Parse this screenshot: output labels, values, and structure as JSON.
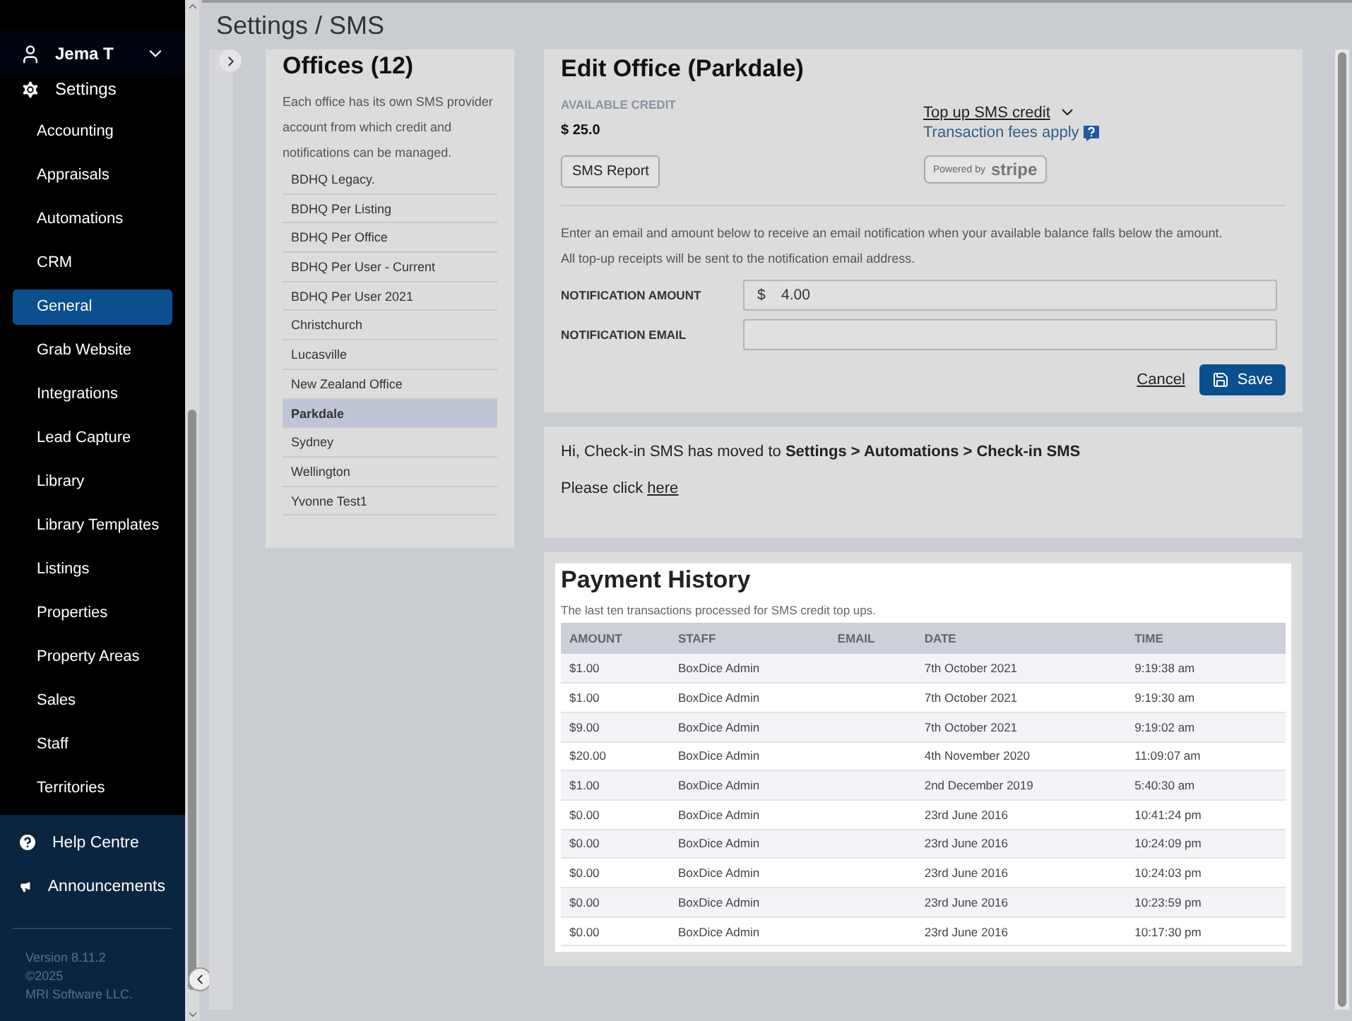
{
  "sidebar": {
    "user": "Jema T",
    "section": "Settings",
    "items": [
      {
        "label": "Accounting",
        "selected": false
      },
      {
        "label": "Appraisals",
        "selected": false
      },
      {
        "label": "Automations",
        "selected": false
      },
      {
        "label": "CRM",
        "selected": false
      },
      {
        "label": "General",
        "selected": true
      },
      {
        "label": "Grab Website",
        "selected": false
      },
      {
        "label": "Integrations",
        "selected": false
      },
      {
        "label": "Lead Capture",
        "selected": false
      },
      {
        "label": "Library",
        "selected": false
      },
      {
        "label": "Library Templates",
        "selected": false
      },
      {
        "label": "Listings",
        "selected": false
      },
      {
        "label": "Properties",
        "selected": false
      },
      {
        "label": "Property Areas",
        "selected": false
      },
      {
        "label": "Sales",
        "selected": false
      },
      {
        "label": "Staff",
        "selected": false
      },
      {
        "label": "Territories",
        "selected": false
      }
    ],
    "footer": [
      {
        "kind": "help",
        "label": "Help Centre"
      },
      {
        "kind": "announce",
        "label": "Announcements"
      }
    ],
    "version": [
      "Version 8.11.2",
      "©2025",
      "MRI Software LLC."
    ]
  },
  "page_title": "Settings / SMS",
  "offices": {
    "title": "Offices (12)",
    "description": "Each office has its own SMS provider account from which credit and notifications can be managed.",
    "items": [
      {
        "name": "BDHQ Legacy.",
        "selected": false
      },
      {
        "name": "BDHQ Per Listing",
        "selected": false
      },
      {
        "name": "BDHQ Per Office",
        "selected": false
      },
      {
        "name": "BDHQ Per User - Current",
        "selected": false
      },
      {
        "name": "BDHQ Per User 2021",
        "selected": false
      },
      {
        "name": "Christchurch",
        "selected": false
      },
      {
        "name": "Lucasville",
        "selected": false
      },
      {
        "name": "New Zealand Office",
        "selected": false
      },
      {
        "name": "Parkdale",
        "selected": true
      },
      {
        "name": "Sydney",
        "selected": false
      },
      {
        "name": "Wellington",
        "selected": false
      },
      {
        "name": "Yvonne Test1",
        "selected": false
      }
    ]
  },
  "edit_office": {
    "title": "Edit Office (Parkdale)",
    "credit_label": "AVAILABLE CREDIT",
    "credit_value": "$ 25.0",
    "report_button": "SMS Report",
    "topup_link": "Top up SMS credit",
    "fees_link": "Transaction fees apply",
    "stripe_badge": {
      "prefix": "Powered by",
      "brand": "stripe"
    },
    "notice": [
      "Enter an email and amount below to receive an email notification when your available balance falls below the amount.",
      "All top-up receipts will be sent to the notification email address."
    ],
    "fields": [
      {
        "label": "NOTIFICATION AMOUNT",
        "prefix": "$",
        "value": "4.00"
      },
      {
        "label": "NOTIFICATION EMAIL"
      }
    ],
    "cancel": "Cancel",
    "save": "Save"
  },
  "message": {
    "text": "Hi, Check-in SMS has moved to **Settings > Automations > Check-in SMS**",
    "click_text": "Please click",
    "link": "here"
  },
  "payment_history": {
    "title": "Payment History",
    "subtitle": "The last ten transactions processed for SMS credit top ups.",
    "columns": [
      "AMOUNT",
      "STAFF",
      "EMAIL",
      "DATE",
      "TIME"
    ],
    "rows": [
      [
        "$1.00",
        "BoxDice Admin",
        "",
        "7th October 2021",
        "9:19:38 am"
      ],
      [
        "$1.00",
        "BoxDice Admin",
        "",
        "7th October 2021",
        "9:19:30 am"
      ],
      [
        "$9.00",
        "BoxDice Admin",
        "",
        "7th October 2021",
        "9:19:02 am"
      ],
      [
        "$20.00",
        "BoxDice Admin",
        "",
        "4th November 2020",
        "11:09:07 am"
      ],
      [
        "$1.00",
        "BoxDice Admin",
        "",
        "2nd December 2019",
        "5:40:30 am"
      ],
      [
        "$0.00",
        "BoxDice Admin",
        "",
        "23rd June 2016",
        "10:41:24 pm"
      ],
      [
        "$0.00",
        "BoxDice Admin",
        "",
        "23rd June 2016",
        "10:24:09 pm"
      ],
      [
        "$0.00",
        "BoxDice Admin",
        "",
        "23rd June 2016",
        "10:24:03 pm"
      ],
      [
        "$0.00",
        "BoxDice Admin",
        "",
        "23rd June 2016",
        "10:23:59 pm"
      ],
      [
        "$0.00",
        "BoxDice Admin",
        "",
        "23rd June 2016",
        "10:17:30 pm"
      ]
    ]
  }
}
